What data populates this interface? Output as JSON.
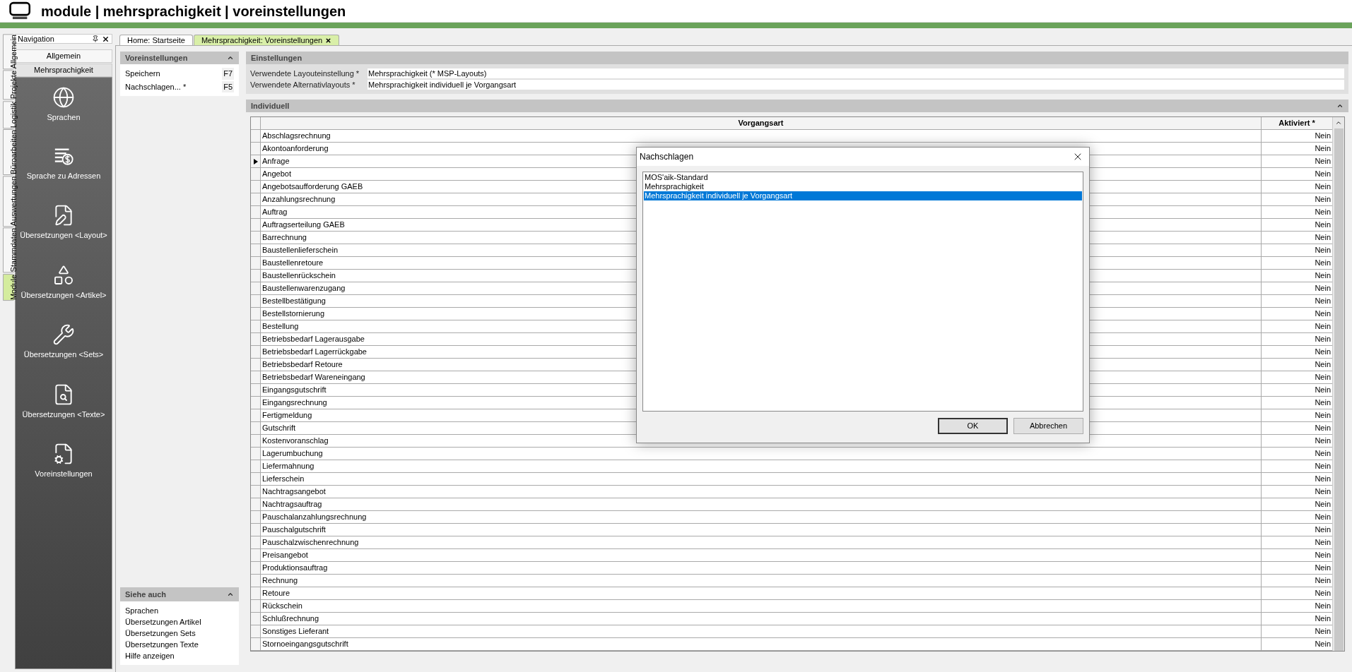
{
  "app_header": {
    "title": "module | mehrsprachigkeit | voreinstellungen"
  },
  "side_tabs": [
    {
      "label": "Allgemein",
      "selected": false
    },
    {
      "label": "Projekte",
      "selected": false
    },
    {
      "label": "Logistik",
      "selected": false
    },
    {
      "label": "Büroarbeiten",
      "selected": false
    },
    {
      "label": "Auswertungen",
      "selected": false
    },
    {
      "label": "Stammdaten",
      "selected": false
    },
    {
      "label": "Module",
      "selected": true
    }
  ],
  "navigation": {
    "title": "Navigation",
    "groups": [
      {
        "label": "Allgemein",
        "selected": false
      },
      {
        "label": "Mehrsprachigkeit",
        "selected": true
      }
    ],
    "items": [
      {
        "label": "Sprachen"
      },
      {
        "label": "Sprache zu Adressen"
      },
      {
        "label": "Übersetzungen <Layout>"
      },
      {
        "label": "Übersetzungen <Artikel>"
      },
      {
        "label": "Übersetzungen <Sets>"
      },
      {
        "label": "Übersetzungen <Texte>"
      },
      {
        "label": "Voreinstellungen"
      }
    ]
  },
  "document_tabs": [
    {
      "label": "Home: Startseite",
      "selected": false,
      "closable": false
    },
    {
      "label": "Mehrsprachigkeit: Voreinstellungen",
      "selected": true,
      "closable": true
    }
  ],
  "actions_panel": {
    "title": "Voreinstellungen",
    "expanded": true,
    "items": [
      {
        "label": "Speichern",
        "shortcut": "F7"
      },
      {
        "label": "Nachschlagen... *",
        "shortcut": "F5"
      }
    ]
  },
  "see_also": {
    "title": "Siehe auch",
    "expanded": true,
    "items": [
      "Sprachen",
      "Übersetzungen Artikel",
      "Übersetzungen Sets",
      "Übersetzungen Texte",
      "Hilfe anzeigen"
    ]
  },
  "settings": {
    "title": "Einstellungen",
    "fields": [
      {
        "label": "Verwendete Layouteinstellung *",
        "value": "Mehrsprachigkeit (* MSP-Layouts)"
      },
      {
        "label": "Verwendete Alternativlayouts *",
        "value": "Mehrsprachigkeit individuell je Vorgangsart"
      }
    ]
  },
  "individual": {
    "title": "Individuell",
    "expanded": true,
    "columns": [
      "Vorgangsart",
      "Aktiviert *"
    ],
    "rows": [
      {
        "vorgangsart": "Abschlagsrechnung",
        "aktiviert": "Nein",
        "selected": false
      },
      {
        "vorgangsart": "Akontoanforderung",
        "aktiviert": "Nein",
        "selected": false
      },
      {
        "vorgangsart": "Anfrage",
        "aktiviert": "Nein",
        "selected": true
      },
      {
        "vorgangsart": "Angebot",
        "aktiviert": "Nein",
        "selected": false
      },
      {
        "vorgangsart": "Angebotsaufforderung GAEB",
        "aktiviert": "Nein",
        "selected": false
      },
      {
        "vorgangsart": "Anzahlungsrechnung",
        "aktiviert": "Nein",
        "selected": false
      },
      {
        "vorgangsart": "Auftrag",
        "aktiviert": "Nein",
        "selected": false
      },
      {
        "vorgangsart": "Auftragserteilung GAEB",
        "aktiviert": "Nein",
        "selected": false
      },
      {
        "vorgangsart": "Barrechnung",
        "aktiviert": "Nein",
        "selected": false
      },
      {
        "vorgangsart": "Baustellenlieferschein",
        "aktiviert": "Nein",
        "selected": false
      },
      {
        "vorgangsart": "Baustellenretoure",
        "aktiviert": "Nein",
        "selected": false
      },
      {
        "vorgangsart": "Baustellenrückschein",
        "aktiviert": "Nein",
        "selected": false
      },
      {
        "vorgangsart": "Baustellenwarenzugang",
        "aktiviert": "Nein",
        "selected": false
      },
      {
        "vorgangsart": "Bestellbestätigung",
        "aktiviert": "Nein",
        "selected": false
      },
      {
        "vorgangsart": "Bestellstornierung",
        "aktiviert": "Nein",
        "selected": false
      },
      {
        "vorgangsart": "Bestellung",
        "aktiviert": "Nein",
        "selected": false
      },
      {
        "vorgangsart": "Betriebsbedarf Lagerausgabe",
        "aktiviert": "Nein",
        "selected": false
      },
      {
        "vorgangsart": "Betriebsbedarf Lagerrückgabe",
        "aktiviert": "Nein",
        "selected": false
      },
      {
        "vorgangsart": "Betriebsbedarf Retoure",
        "aktiviert": "Nein",
        "selected": false
      },
      {
        "vorgangsart": "Betriebsbedarf Wareneingang",
        "aktiviert": "Nein",
        "selected": false
      },
      {
        "vorgangsart": "Eingangsgutschrift",
        "aktiviert": "Nein",
        "selected": false
      },
      {
        "vorgangsart": "Eingangsrechnung",
        "aktiviert": "Nein",
        "selected": false
      },
      {
        "vorgangsart": "Fertigmeldung",
        "aktiviert": "Nein",
        "selected": false
      },
      {
        "vorgangsart": "Gutschrift",
        "aktiviert": "Nein",
        "selected": false
      },
      {
        "vorgangsart": "Kostenvoranschlag",
        "aktiviert": "Nein",
        "selected": false
      },
      {
        "vorgangsart": "Lagerumbuchung",
        "aktiviert": "Nein",
        "selected": false
      },
      {
        "vorgangsart": "Liefermahnung",
        "aktiviert": "Nein",
        "selected": false
      },
      {
        "vorgangsart": "Lieferschein",
        "aktiviert": "Nein",
        "selected": false
      },
      {
        "vorgangsart": "Nachtragsangebot",
        "aktiviert": "Nein",
        "selected": false
      },
      {
        "vorgangsart": "Nachtragsauftrag",
        "aktiviert": "Nein",
        "selected": false
      },
      {
        "vorgangsart": "Pauschalanzahlungsrechnung",
        "aktiviert": "Nein",
        "selected": false
      },
      {
        "vorgangsart": "Pauschalgutschrift",
        "aktiviert": "Nein",
        "selected": false
      },
      {
        "vorgangsart": "Pauschalzwischenrechnung",
        "aktiviert": "Nein",
        "selected": false
      },
      {
        "vorgangsart": "Preisangebot",
        "aktiviert": "Nein",
        "selected": false
      },
      {
        "vorgangsart": "Produktionsauftrag",
        "aktiviert": "Nein",
        "selected": false
      },
      {
        "vorgangsart": "Rechnung",
        "aktiviert": "Nein",
        "selected": false
      },
      {
        "vorgangsart": "Retoure",
        "aktiviert": "Nein",
        "selected": false
      },
      {
        "vorgangsart": "Rückschein",
        "aktiviert": "Nein",
        "selected": false
      },
      {
        "vorgangsart": "Schlußrechnung",
        "aktiviert": "Nein",
        "selected": false
      },
      {
        "vorgangsart": "Sonstiges Lieferant",
        "aktiviert": "Nein",
        "selected": false
      },
      {
        "vorgangsart": "Stornoeingangsgutschrift",
        "aktiviert": "Nein",
        "selected": false
      }
    ]
  },
  "dialog": {
    "title": "Nachschlagen",
    "items": [
      {
        "label": "MOS'aik-Standard",
        "selected": false
      },
      {
        "label": "Mehrsprachigkeit",
        "selected": false
      },
      {
        "label": "Mehrsprachigkeit individuell je Vorgangsart",
        "selected": true
      }
    ],
    "buttons": [
      {
        "label": "OK",
        "default": true
      },
      {
        "label": "Abbrechen",
        "default": false
      }
    ]
  }
}
